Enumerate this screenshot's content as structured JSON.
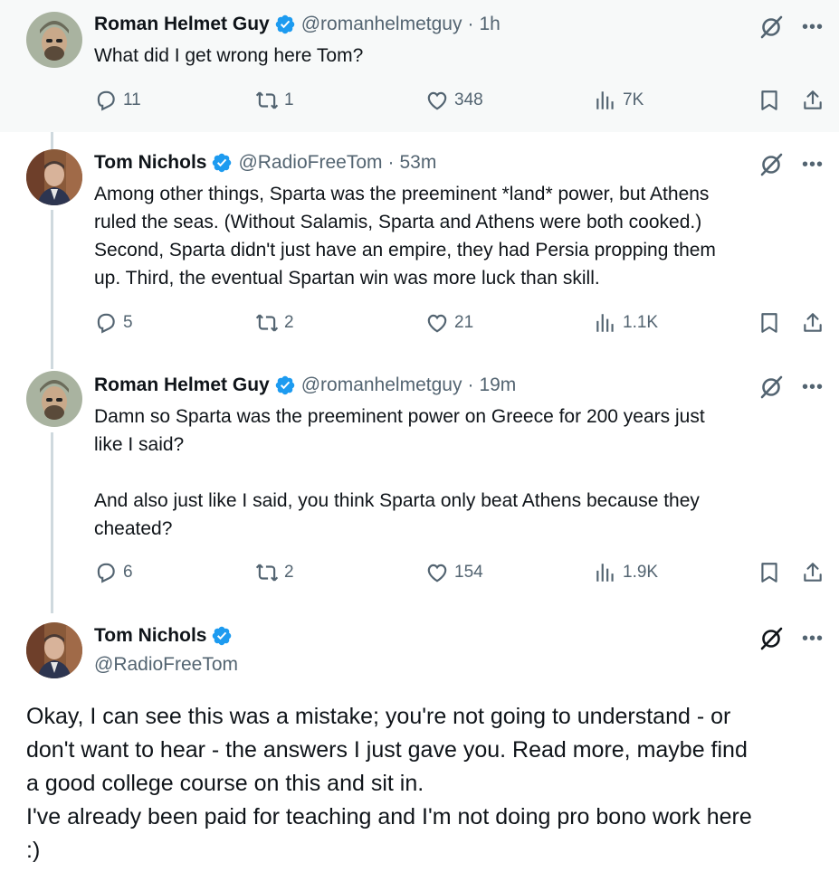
{
  "colors": {
    "accent": "#1d9bf0",
    "muted": "#536471",
    "text": "#0f1419",
    "thread_line": "#cfd9de",
    "highlight_bg": "#f7f9f9"
  },
  "tweets": [
    {
      "name": "Roman Helmet Guy",
      "handle": "@romanhelmetguy",
      "time": "1h",
      "text": "What did I get wrong here Tom?",
      "replies": "11",
      "retweets": "1",
      "likes": "348",
      "views": "7K"
    },
    {
      "name": "Tom Nichols",
      "handle": "@RadioFreeTom",
      "time": "53m",
      "text": "Among other things, Sparta was the preeminent *land* power, but Athens\nruled the seas. (Without Salamis, Sparta and Athens were both cooked.)\nSecond, Sparta didn't just have an empire, they had Persia propping them\nup. Third, the eventual Spartan win was more luck than skill.",
      "replies": "5",
      "retweets": "2",
      "likes": "21",
      "views": "1.1K"
    },
    {
      "name": "Roman Helmet Guy",
      "handle": "@romanhelmetguy",
      "time": "19m",
      "text": "Damn so Sparta was the preeminent power on Greece for 200 years just\nlike I said?\n\nAnd also just like I said, you think Sparta only beat Athens because they\ncheated?",
      "replies": "6",
      "retweets": "2",
      "likes": "154",
      "views": "1.9K"
    }
  ],
  "main_tweet": {
    "name": "Tom Nichols",
    "handle": "@RadioFreeTom",
    "text": "Okay, I can see this was a mistake; you're not going to understand - or\ndon't want to hear - the answers I just gave you. Read more, maybe find\na good college course on this and sit in.\nI've already been paid for teaching and I'm not doing pro bono work here\n:)"
  },
  "icons": [
    "verified-badge-icon",
    "grok-icon",
    "more-icon",
    "reply-icon",
    "retweet-icon",
    "like-icon",
    "views-icon",
    "bookmark-icon",
    "share-icon"
  ]
}
